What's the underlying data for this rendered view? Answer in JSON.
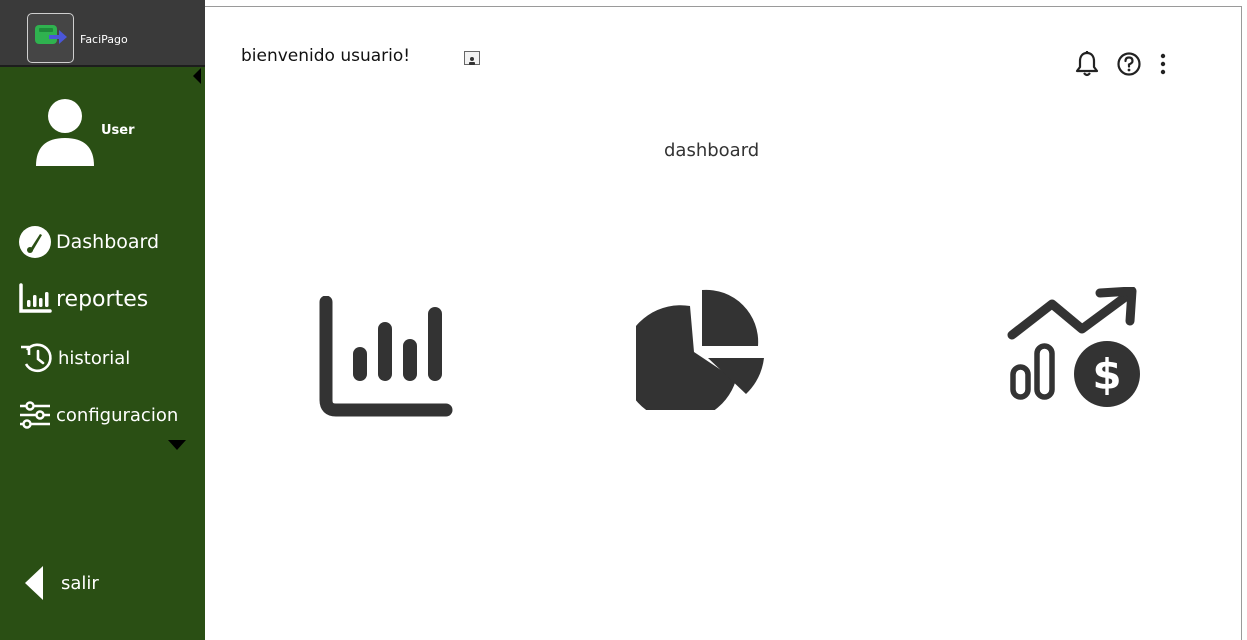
{
  "brand": {
    "name": "FaciPago"
  },
  "sidebar": {
    "user": {
      "name": "User"
    },
    "items": [
      {
        "label": "Dashboard",
        "icon": "speedometer-icon"
      },
      {
        "label": "reportes",
        "icon": "bar-chart-icon"
      },
      {
        "label": "historial",
        "icon": "history-icon"
      },
      {
        "label": "configuracion",
        "icon": "sliders-icon"
      }
    ],
    "logout": {
      "label": "salir",
      "icon": "caret-left-icon"
    }
  },
  "header": {
    "welcome": "bienvenido usuario!",
    "actions": [
      "bell-icon",
      "help-icon",
      "more-vertical-icon"
    ]
  },
  "main": {
    "title": "dashboard",
    "cards": [
      {
        "icon": "bar-chart-icon"
      },
      {
        "icon": "pie-chart-icon"
      },
      {
        "icon": "revenue-growth-icon"
      }
    ]
  },
  "colors": {
    "sidebar": "#2a4f14",
    "brand_bar": "#3a3a3a",
    "icon_dark": "#333333",
    "text_light": "#ffffff"
  }
}
